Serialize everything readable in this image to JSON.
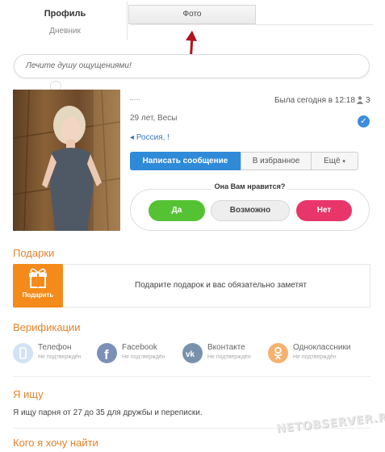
{
  "tabs": {
    "profile": "Профиль",
    "diary": "Дневник",
    "photo": "Фото"
  },
  "status": {
    "placeholder": "Лечите душу ощущениями!"
  },
  "profile": {
    "age_zodiac": "29 лет, Весы",
    "location": "Россия, !",
    "last_seen": "Была сегодня в 12:18",
    "friends_count": "3"
  },
  "actions": {
    "message": "Написать сообщение",
    "favorite": "В избранное",
    "more": "Ещё"
  },
  "like": {
    "question": "Она Вам нравится?",
    "yes": "Да",
    "maybe": "Возможно",
    "no": "Нет"
  },
  "gifts": {
    "title": "Подарки",
    "button": "Подарить",
    "text": "Подарите подарок и вас обязательно заметят"
  },
  "verifications": {
    "title": "Верификации",
    "items": [
      {
        "name": "Телефон",
        "status": "Не подтверждён",
        "color": "#b9d3ec",
        "icon": "phone-icon"
      },
      {
        "name": "Facebook",
        "status": "Не подтверждён",
        "color": "#6d84b4",
        "icon": "facebook-icon"
      },
      {
        "name": "Вконтакте",
        "status": "Не подтверждён",
        "color": "#6b87a8",
        "icon": "vk-icon"
      },
      {
        "name": "Одноклассники",
        "status": "Не подтверждён",
        "color": "#f3a65a",
        "icon": "odnoklassniki-icon"
      }
    ]
  },
  "seeking": {
    "title": "Я ищу",
    "text": "Я ищу парня от 27 до 35 для дружбы и переписки."
  },
  "who": {
    "title": "Кого я хочу найти"
  },
  "watermark": "NETOBSERVER.RU",
  "colors": {
    "accent": "#2f8ad8",
    "section": "#e5832c",
    "yes": "#55c233",
    "no": "#e8356a",
    "gift": "#f38a1a"
  }
}
